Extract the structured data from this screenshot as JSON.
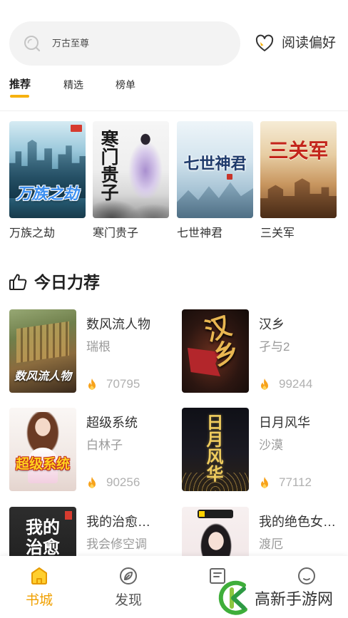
{
  "search": {
    "placeholder": "万古至尊",
    "icon": "search-icon"
  },
  "header": {
    "preference_label": "阅读偏好",
    "preference_icon": "heart-icon"
  },
  "tabs": [
    {
      "label": "推荐",
      "active": true
    },
    {
      "label": "精选",
      "active": false
    },
    {
      "label": "榜单",
      "active": false
    }
  ],
  "featured": [
    {
      "title": "万族之劫",
      "cover_text": "万族之劫"
    },
    {
      "title": "寒门贵子",
      "cover_text": "寒门贵子"
    },
    {
      "title": "七世神君",
      "cover_text": "七世神君"
    },
    {
      "title": "三关军",
      "cover_text": "三关军"
    }
  ],
  "today": {
    "heading": "今日力荐",
    "heading_icon": "thumbs-up-icon",
    "heat_icon": "fire-icon",
    "books": [
      {
        "title": "数风流人物",
        "author": "瑞根",
        "heat": 70795,
        "cover_text": "数风流人物"
      },
      {
        "title": "汉乡",
        "author": "孑与2",
        "heat": 99244,
        "cover_text": "汉乡"
      },
      {
        "title": "超级系统",
        "author": "白林子",
        "heat": 90256,
        "cover_text": "超级系统"
      },
      {
        "title": "日月风华",
        "author": "沙漠",
        "heat": 77112,
        "cover_text": "日月风华"
      },
      {
        "title": "我的治愈…",
        "author": "我会修空调",
        "cover_text": "我的治愈系"
      },
      {
        "title": "我的绝色女…",
        "author": "渡厄"
      }
    ]
  },
  "nav": [
    {
      "label": "书城",
      "icon": "bookstore-icon",
      "active": true
    },
    {
      "label": "发现",
      "icon": "discover-icon",
      "active": false
    },
    {
      "icon": "bookshelf-icon",
      "active": false
    },
    {
      "icon": "profile-icon",
      "active": false
    }
  ],
  "watermark": {
    "text": "高新手游网"
  },
  "colors": {
    "accent": "#f6b10f",
    "active_nav_label": "#f0a000",
    "heat_icon": "#f7a21b",
    "author_text": "#9a9a9a",
    "search_background": "#f3f3f3"
  }
}
